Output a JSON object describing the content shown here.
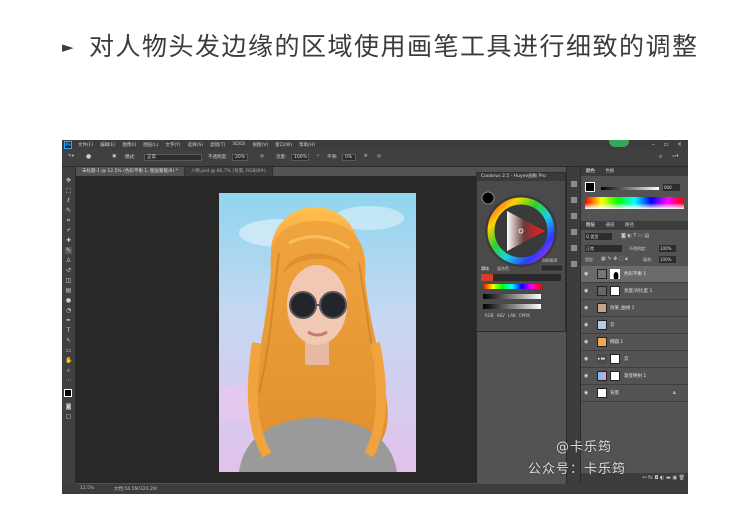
{
  "instruction": {
    "text": "对人物头发边缘的区域使用画笔工具进行细致的调整"
  },
  "ps": {
    "logo": "Ps",
    "menus": [
      "文件(F)",
      "编辑(E)",
      "图像(I)",
      "图层(L)",
      "文字(Y)",
      "选择(S)",
      "滤镜(T)",
      "3D(D)",
      "视图(V)",
      "窗口(W)",
      "帮助(H)"
    ],
    "options": {
      "mode_label": "模式:",
      "mode_value": "正常",
      "opacity_label": "不透明度:",
      "opacity_value": "20%",
      "flow_label": "流量:",
      "flow_value": "100%",
      "smooth_label": "平滑:",
      "smooth_value": "0%"
    },
    "tabs": [
      "未标题-1 @ 12.5% (色彩平衡 1, 图层蒙版/8) *",
      "人物.psd @ 66.7% (背景, RGB/8#)"
    ],
    "statusbar": {
      "zoom": "12.5%",
      "doc": "文档:56.5M/320.2M"
    },
    "color_panel": {
      "title": "Coolorus 2.5 - Huyen画板 Pro",
      "tabs": [
        "滑块",
        "混合色"
      ],
      "modes": [
        "RGB",
        "HSV",
        "LAB",
        "CMYK"
      ],
      "hex_value": "000000"
    },
    "right_panel": {
      "top_tabs": [
        "颜色",
        "色板"
      ],
      "hex_value": "000",
      "layer_tabs": [
        "图层",
        "通道",
        "路径"
      ],
      "kind_label": "Q 类型",
      "blend_mode": "正常",
      "opacity_label": "不透明度:",
      "opacity_value": "100%",
      "lock_label": "锁定:",
      "fill_label": "填充:",
      "fill_value": "100%",
      "layers": [
        {
          "name": "色彩平衡 1",
          "selected": true
        },
        {
          "name": "亮度/对比度 1",
          "selected": false
        },
        {
          "name": "效果_曲线 1",
          "selected": false
        },
        {
          "name": "云",
          "selected": false
        },
        {
          "name": "椭圆 1",
          "selected": false
        },
        {
          "name": "云",
          "selected": false
        },
        {
          "name": "渐变映射 1",
          "selected": false
        },
        {
          "name": "背景",
          "selected": false
        }
      ]
    }
  },
  "watermark": {
    "line1": "@卡乐筠",
    "line2": "公众号：卡乐筠"
  },
  "colors": {
    "ps_bg": "#535353",
    "canvas": "#282828",
    "hair": "#e9a84a",
    "sun": "#ff9a3c"
  }
}
